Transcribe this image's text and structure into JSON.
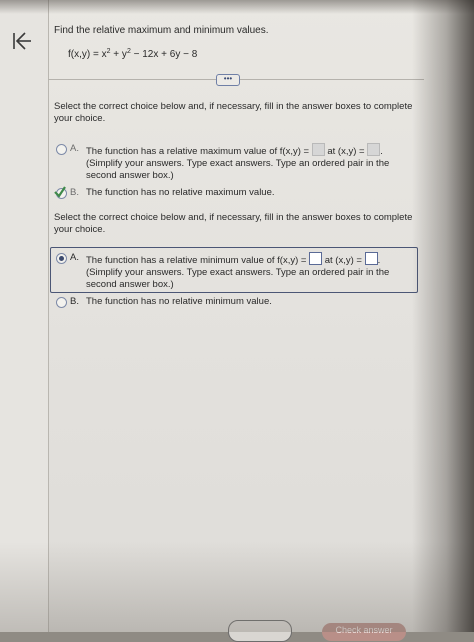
{
  "problem": {
    "title": "Find the relative maximum and minimum values.",
    "function_prefix": "f(x,y) = x",
    "exp1": "2",
    "function_mid": " + y",
    "exp2": "2",
    "function_suffix": " − 12x + 6y − 8",
    "more_label": "•••"
  },
  "part1": {
    "instruction": "Select the correct choice below and, if necessary, fill in the answer boxes to complete your choice.",
    "option_a": {
      "letter": "A.",
      "text_before": "The function has a relative maximum value of f(x,y) =",
      "text_mid": " at (x,y) =",
      "text_after": ".",
      "hint": "(Simplify your answers. Type exact answers. Type an ordered pair in the second answer box.)"
    },
    "option_b": {
      "letter": "B.",
      "text": "The function has no relative maximum value."
    }
  },
  "part2": {
    "instruction": "Select the correct choice below and, if necessary, fill in the answer boxes to complete your choice.",
    "option_a": {
      "letter": "A.",
      "text_before": "The function has a relative minimum value of f(x,y) =",
      "text_mid": " at (x,y) =",
      "text_after": ".",
      "hint": "(Simplify your answers. Type exact answers. Type an ordered pair in the second answer box.)"
    },
    "option_b": {
      "letter": "B.",
      "text": "The function has no relative minimum value."
    }
  },
  "footer": {
    "check_answer_label": "Check answer"
  },
  "colors": {
    "accent": "#3c4a6e",
    "check_green": "#3f8a4a",
    "check_answer_bg": "#b98f88"
  }
}
